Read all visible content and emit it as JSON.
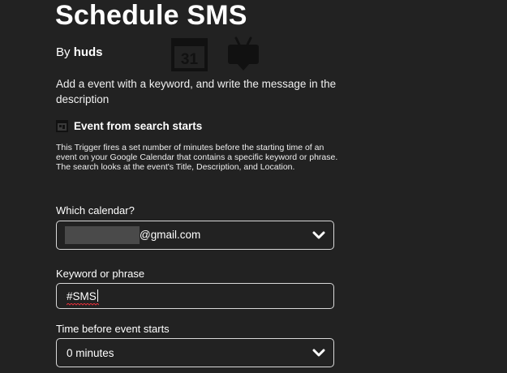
{
  "applet": {
    "title": "Schedule SMS",
    "by_prefix": "By",
    "author": "huds",
    "description": "Add a event with a keyword, and write the message in the description"
  },
  "icons": {
    "calendar_icon": "google-calendar-icon",
    "calendar_day": "31",
    "android_icon": "android-icon"
  },
  "trigger": {
    "icon": "calendar-icon",
    "title": "Event from search starts",
    "description": "This Trigger fires a set number of minutes before the starting time of an event on your Google Calendar that contains a specific keyword or phrase. The search looks at the event's Title, Description, and Location."
  },
  "fields": {
    "calendar": {
      "label": "Which calendar?",
      "value": "@gmail.com"
    },
    "keyword": {
      "label": "Keyword or phrase",
      "value": "#SMS"
    },
    "time_before": {
      "label": "Time before event starts",
      "value": "0 minutes"
    }
  },
  "colors": {
    "background": "#222222",
    "text": "#ffffff",
    "field_border": "#d9d9d9",
    "redaction": "#4a4a4a",
    "spellcheck": "#e0303a"
  }
}
